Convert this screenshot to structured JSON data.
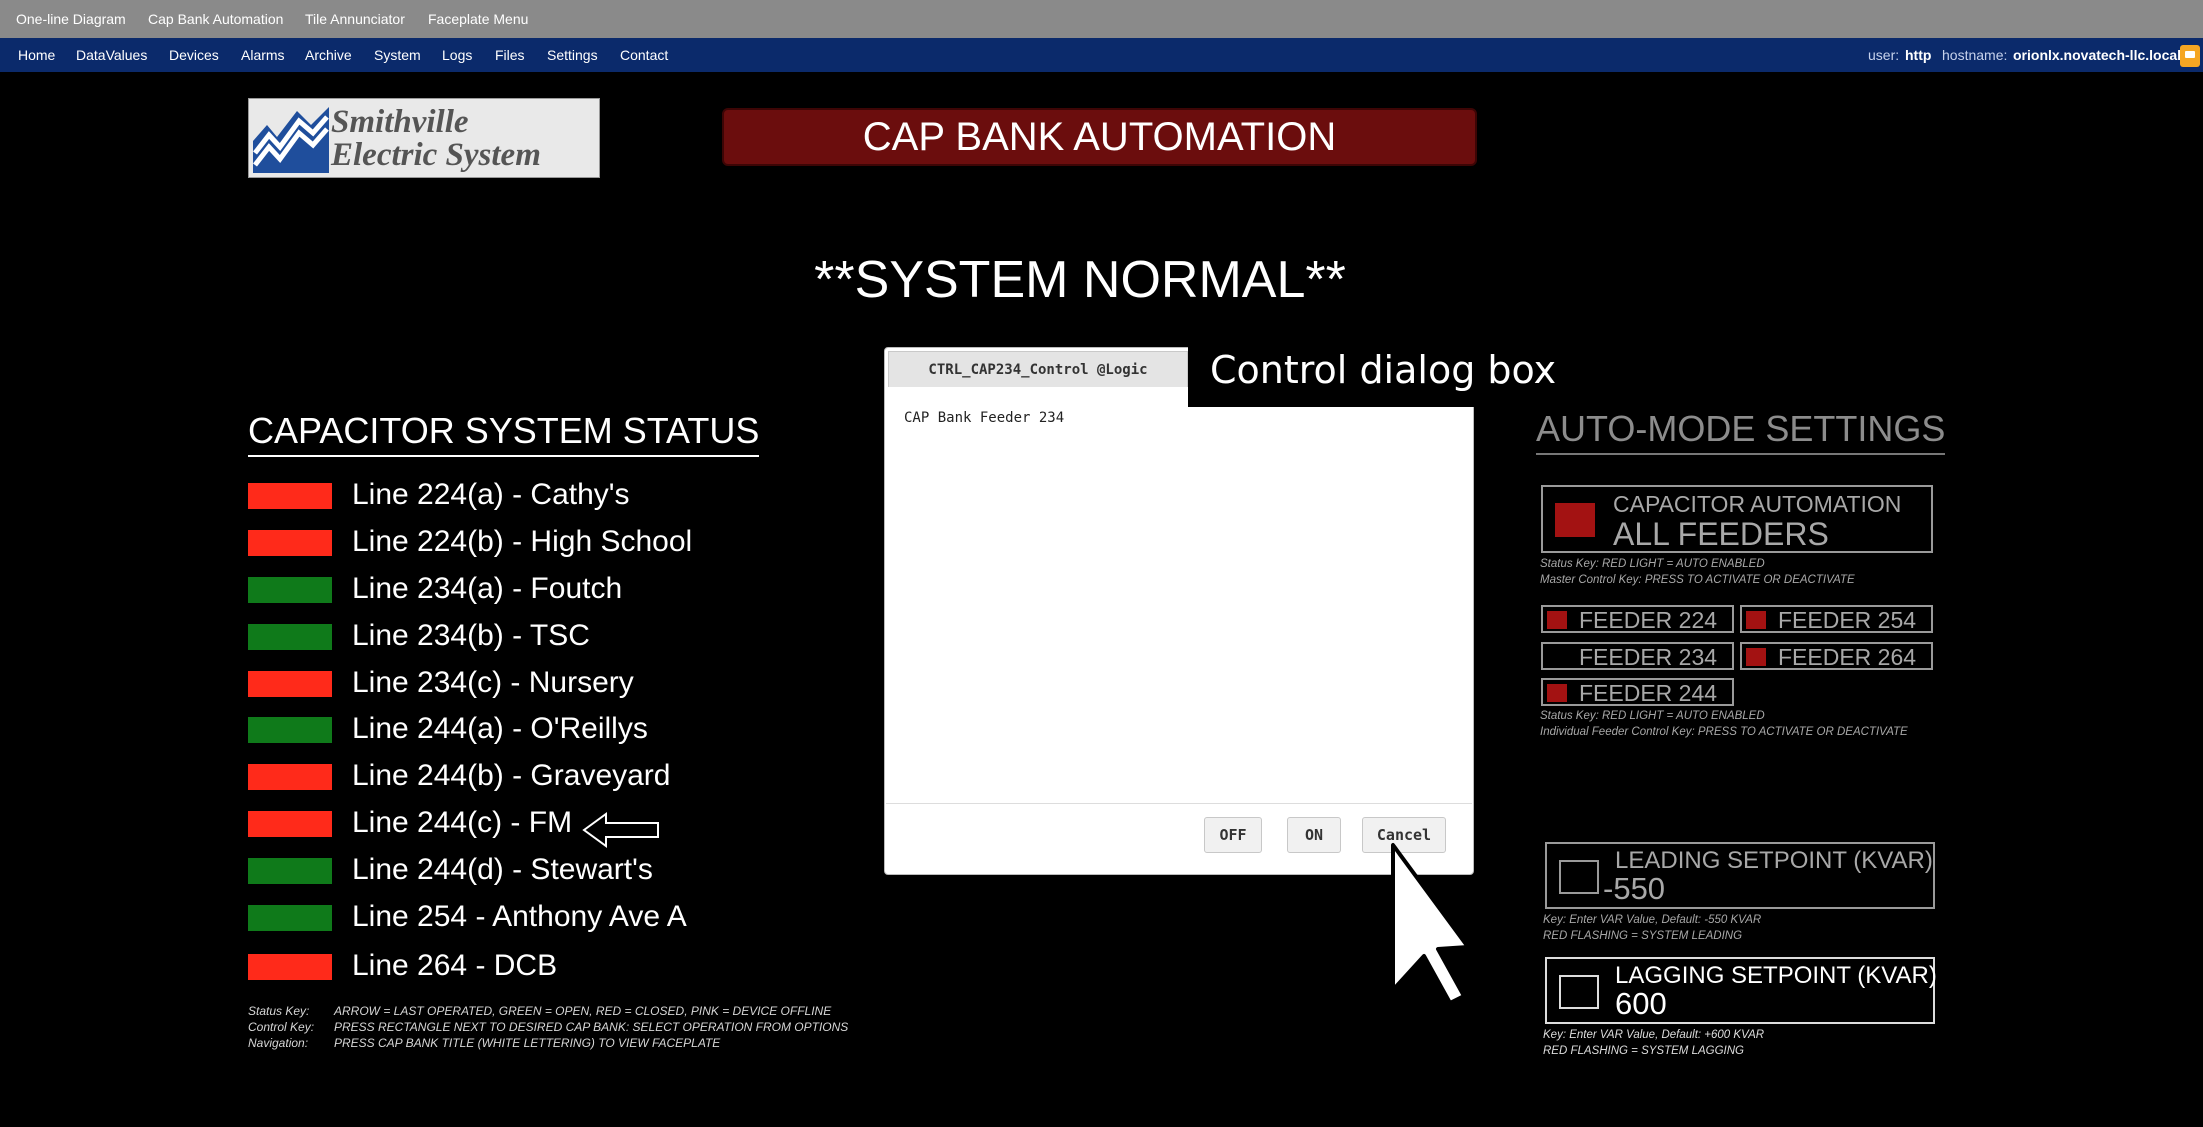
{
  "top_menu": [
    "One-line Diagram",
    "Cap Bank Automation",
    "Tile Annunciator",
    "Faceplate Menu"
  ],
  "nav": {
    "items": [
      "Home",
      "DataValues",
      "Devices",
      "Alarms",
      "Archive",
      "System",
      "Logs",
      "Files",
      "Settings",
      "Contact"
    ],
    "user_label": "user:",
    "user_value": "http",
    "host_label": "hostname:",
    "host_value": "orionlx.novatech-llc.local",
    "lock_icon": "lock-icon"
  },
  "logo": {
    "line1": "Smithville",
    "line2": "Electric System"
  },
  "banner": "CAP BANK AUTOMATION",
  "system_status": "**SYSTEM NORMAL**",
  "capacitor_status": {
    "title": "CAPACITOR SYSTEM STATUS",
    "lines": [
      {
        "label": "Line 224(a) - Cathy's",
        "color": "#ff2a1a"
      },
      {
        "label": "Line 224(b) - High School",
        "color": "#ff2a1a"
      },
      {
        "label": "Line 234(a) - Foutch",
        "color": "#0f7a1a"
      },
      {
        "label": "Line 234(b) - TSC",
        "color": "#0f7a1a"
      },
      {
        "label": "Line 234(c) - Nursery",
        "color": "#ff2a1a"
      },
      {
        "label": "Line 244(a) - O'Reillys",
        "color": "#0f7a1a"
      },
      {
        "label": "Line 244(b) - Graveyard",
        "color": "#ff2a1a"
      },
      {
        "label": "Line 244(c) - FM",
        "color": "#ff2a1a",
        "last_operated": true
      },
      {
        "label": "Line 244(d) - Stewart's",
        "color": "#0f7a1a"
      },
      {
        "label": "Line 254 - Anthony Ave A",
        "color": "#0f7a1a"
      },
      {
        "label": "Line 264 - DCB",
        "color": "#ff2a1a"
      }
    ],
    "keys": [
      {
        "key": "Status Key:",
        "text": "ARROW = LAST OPERATED,  GREEN = OPEN, RED = CLOSED, PINK = DEVICE OFFLINE"
      },
      {
        "key": "Control Key:",
        "text": "PRESS RECTANGLE NEXT TO DESIRED CAP BANK: SELECT OPERATION FROM OPTIONS"
      },
      {
        "key": "Navigation:",
        "text": "PRESS CAP BANK TITLE (WHITE LETTERING) TO VIEW FACEPLATE"
      }
    ]
  },
  "dialog": {
    "tab": "CTRL_CAP234_Control @Logic",
    "body": "CAP Bank Feeder 234",
    "buttons": {
      "off": "OFF",
      "on": "ON",
      "cancel": "Cancel"
    },
    "callout": "Control dialog box"
  },
  "auto_mode": {
    "title": "AUTO-MODE SETTINGS",
    "all_feeders": {
      "line1": "CAPACITOR AUTOMATION",
      "line2": "ALL FEEDERS",
      "key1": "Status Key: RED LIGHT = AUTO ENABLED",
      "key2": "Master Control Key: PRESS TO ACTIVATE OR DEACTIVATE"
    },
    "feeders": [
      {
        "label": "FEEDER 224",
        "enabled": true
      },
      {
        "label": "FEEDER 254",
        "enabled": true
      },
      {
        "label": "FEEDER 234",
        "enabled": false
      },
      {
        "label": "FEEDER 264",
        "enabled": true
      },
      {
        "label": "FEEDER 244",
        "enabled": true
      }
    ],
    "feeder_key1": "Status Key: RED LIGHT = AUTO ENABLED",
    "feeder_key2": "Individual Feeder Control Key: PRESS TO ACTIVATE OR DEACTIVATE",
    "leading": {
      "title": "LEADING SETPOINT (KVAR)",
      "value": "-550",
      "key1": "Key:  Enter VAR Value, Default: -550 KVAR",
      "key2": "RED FLASHING = SYSTEM LEADING"
    },
    "lagging": {
      "title": "LAGGING SETPOINT (KVAR)",
      "value": "600",
      "key1": "Key:  Enter VAR Value, Default: +600 KVAR",
      "key2": "RED FLASHING = SYSTEM LAGGING"
    }
  }
}
